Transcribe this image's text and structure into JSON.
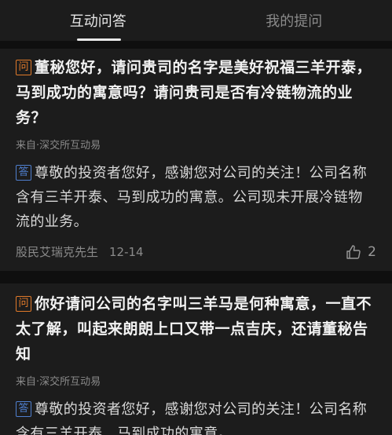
{
  "tabs": [
    {
      "label": "互动问答",
      "active": true
    },
    {
      "label": "我的提问",
      "active": false
    }
  ],
  "badges": {
    "question": "问",
    "answer": "答"
  },
  "items": [
    {
      "question": "董秘您好，请问贵司的名字是美好祝福三羊开泰，马到成功的寓意吗？请问贵司是否有冷链物流的业务？",
      "source": "来自·深交所互动易",
      "answer": "尊敬的投资者您好，感谢您对公司的关注！公司名称含有三羊开泰、马到成功的寓意。公司现未开展冷链物流的业务。",
      "author": "股民艾瑞克先生",
      "date": "12-14",
      "likes": "2"
    },
    {
      "question": "你好请问公司的名字叫三羊马是何种寓意，一直不太了解，叫起来朗朗上口又带一点吉庆，还请董秘告知",
      "source": "来自·深交所互动易",
      "answer": "尊敬的投资者您好，感谢您对公司的关注！公司名称含有三羊开泰、马到成功的寓意。"
    }
  ],
  "colors": {
    "background": "#141414",
    "card": "#1c1c1c",
    "question_badge": "#e07a2a",
    "answer_badge": "#4f7fcf"
  },
  "icons": {
    "like": "thumbs-up-icon"
  }
}
